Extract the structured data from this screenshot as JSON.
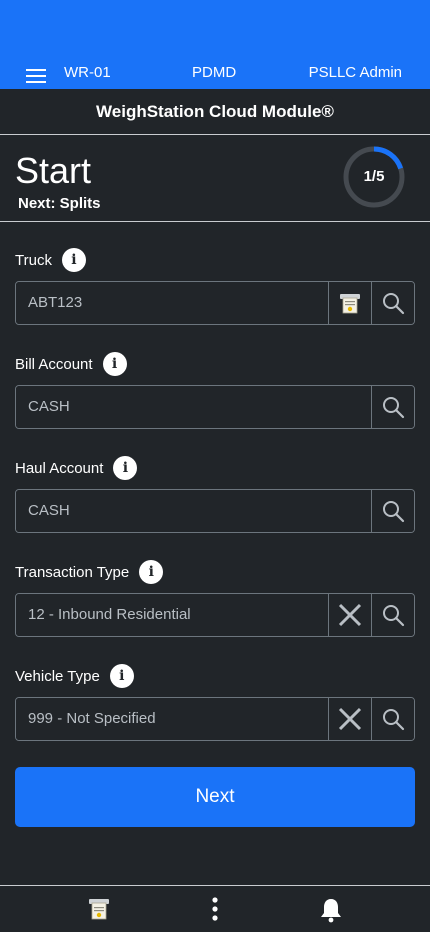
{
  "header": {
    "station": "WR-01",
    "site": "PDMD",
    "user": "PSLLC Admin"
  },
  "module_title": "WeighStation Cloud Module®",
  "step": {
    "title": "Start",
    "next": "Next: Splits",
    "progress_label": "1/5",
    "progress_fraction": 0.2
  },
  "fields": {
    "truck": {
      "label": "Truck",
      "value": "ABT123"
    },
    "bill_account": {
      "label": "Bill Account",
      "value": "CASH"
    },
    "haul_account": {
      "label": "Haul Account",
      "value": "CASH"
    },
    "transaction_type": {
      "label": "Transaction Type",
      "value": "12 - Inbound Residential"
    },
    "vehicle_type": {
      "label": "Vehicle Type",
      "value": "999 - Not Specified"
    }
  },
  "info_glyph": "i",
  "next_button": "Next",
  "colors": {
    "primary": "#1a73f8",
    "background": "#212529",
    "border": "#6c757d"
  }
}
